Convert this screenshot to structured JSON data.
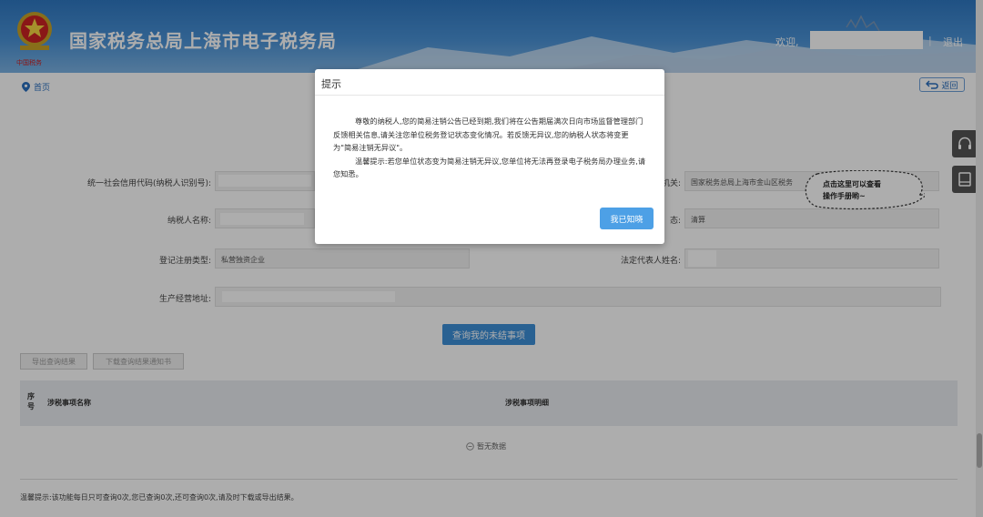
{
  "header": {
    "site_title": "国家税务总局上海市电子税务局",
    "emblem_caption": "中国税务",
    "welcome": "欢迎,",
    "separator": "|",
    "logout": "退出"
  },
  "breadcrumb": {
    "home": "首页"
  },
  "back_button": "返回",
  "form": {
    "credit_code_label": "统一社会信用代码(纳税人识别号):",
    "tax_authority_label_partial": "机关:",
    "tax_authority_value": "国家税务总局上海市金山区税务",
    "taxpayer_name_label": "纳税人名称:",
    "status_label_partial": "态:",
    "status_value": "清算",
    "registration_type_label": "登记注册类型:",
    "registration_type_value": "私营独资企业",
    "legal_rep_label": "法定代表人姓名:",
    "address_label": "生产经营地址:"
  },
  "buttons": {
    "query": "查询我的未结事项",
    "export_result": "导出查询结果",
    "download_notice": "下载查询结果通知书"
  },
  "table": {
    "col_index": "序号",
    "col_name": "涉税事项名称",
    "col_detail": "涉税事项明细",
    "empty_text": "暂无数据"
  },
  "footer_tip": "温馨提示:该功能每日只可查询0次,您已查询0次,还可查询0次,请及时下载或导出结果。",
  "help_balloon": {
    "line1": "点击这里可以查看",
    "line2": "操作手册哟~"
  },
  "modal": {
    "title": "提示",
    "para1": "尊敬的纳税人,您的简易注销公告已经到期,我们将在公告期届满次日向市场监督管理部门反馈相关信息,请关注您单位税务登记状态变化情况。若反馈无异议,您的纳税人状态将变更为\"简易注销无异议\"。",
    "para2": "温馨提示:若您单位状态变为简易注销无异议,您单位将无法再登录电子税务局办理业务,请您知悉。",
    "ok_button": "我已知晓"
  },
  "colors": {
    "header_blue": "#2f78c2",
    "primary_button": "#4da0e6",
    "link_blue": "#2a6fbe"
  },
  "icons": [
    "location-pin-icon",
    "back-arrow-icon",
    "headset-icon",
    "manual-book-icon",
    "empty-data-icon"
  ]
}
